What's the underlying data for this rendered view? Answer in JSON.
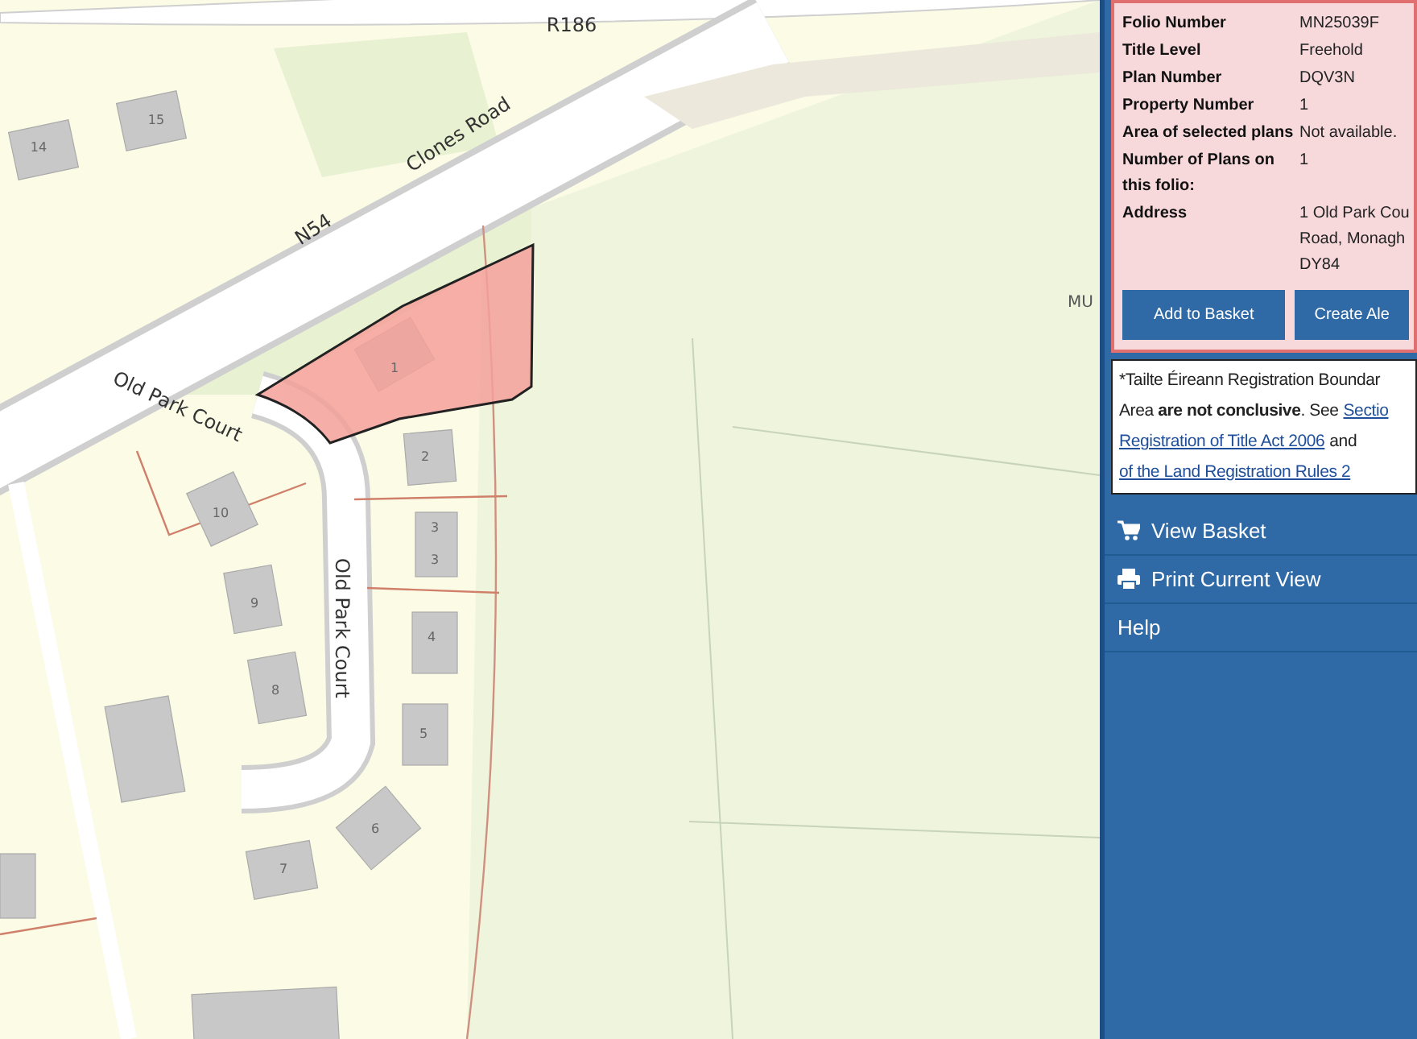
{
  "map": {
    "labels": [
      {
        "text": "R186",
        "kind": "road"
      },
      {
        "text": "Clones Road",
        "kind": "road"
      },
      {
        "text": "N54",
        "kind": "road"
      },
      {
        "text": "Old Park Court",
        "kind": "road"
      },
      {
        "text": "Old Park Court",
        "kind": "road"
      },
      {
        "text": "14",
        "kind": "house"
      },
      {
        "text": "15",
        "kind": "house"
      },
      {
        "text": "1",
        "kind": "house"
      },
      {
        "text": "2",
        "kind": "house"
      },
      {
        "text": "3",
        "kind": "house"
      },
      {
        "text": "3",
        "kind": "house"
      },
      {
        "text": "4",
        "kind": "house"
      },
      {
        "text": "5",
        "kind": "house"
      },
      {
        "text": "6",
        "kind": "house"
      },
      {
        "text": "7",
        "kind": "house"
      },
      {
        "text": "8",
        "kind": "house"
      },
      {
        "text": "9",
        "kind": "house"
      },
      {
        "text": "10",
        "kind": "house"
      },
      {
        "text": "MU",
        "kind": "area"
      }
    ]
  },
  "details": {
    "rows": [
      {
        "label": "Folio Number",
        "value": [
          "MN25039F"
        ]
      },
      {
        "label": "Title Level",
        "value": [
          "Freehold"
        ]
      },
      {
        "label": "Plan Number",
        "value": [
          "DQV3N"
        ]
      },
      {
        "label": "Property Number",
        "value": [
          "1"
        ]
      },
      {
        "label": "Area of selected plans",
        "value": [
          "Not available."
        ]
      },
      {
        "label": "Number of Plans on this folio:",
        "value": [
          "1"
        ]
      },
      {
        "label": "Address",
        "value": [
          "1 Old Park Cou",
          "Road, Monagh",
          "DY84"
        ]
      }
    ],
    "buttons": [
      "Add to Basket",
      "Create Ale"
    ]
  },
  "disclaimer": {
    "lines": [
      [
        {
          "kind": "text",
          "text": "*Tailte Éireann Registration Boundar"
        }
      ],
      [
        {
          "kind": "text",
          "text": "Area **are not conclusive**. See"
        },
        {
          "kind": "link",
          "text": "Sectio"
        }
      ],
      [
        {
          "kind": "link",
          "text": "Registration of Title Act 2006"
        },
        {
          "kind": "text",
          "text": "and"
        }
      ],
      [
        {
          "kind": "link",
          "text": "of the Land Registration Rules 2"
        }
      ]
    ]
  },
  "menu": [
    {
      "label": "View Basket"
    },
    {
      "label": "Print Current View"
    },
    {
      "label": "Help"
    }
  ]
}
